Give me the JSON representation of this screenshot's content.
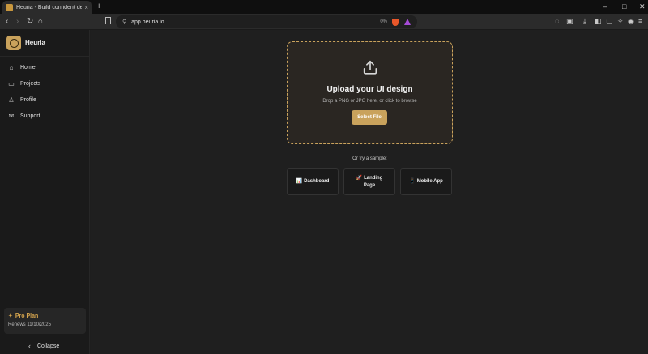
{
  "browser": {
    "tab_title": "Heuria - Build confident design",
    "tab_close": "×",
    "new_tab": "+",
    "url": "app.heuria.io",
    "page_zoom": "0%",
    "window_controls": {
      "minimize": "–",
      "maximize": "□",
      "close": "✕"
    },
    "nav": {
      "back": "‹",
      "forward": "›",
      "reload": "↻",
      "home": "⌂"
    },
    "toolbar_icons": [
      "messages-icon",
      "reader-icon",
      "download-icon",
      "sidebar-icon",
      "wallet-icon",
      "extensions-icon",
      "vpn-icon",
      "menu-icon"
    ]
  },
  "sidebar": {
    "brand": "Heuria",
    "items": [
      {
        "label": "Home",
        "icon": "home-icon",
        "glyph": "⌂"
      },
      {
        "label": "Projects",
        "icon": "folder-icon",
        "glyph": "▭"
      },
      {
        "label": "Profile",
        "icon": "user-icon",
        "glyph": "♙"
      },
      {
        "label": "Support",
        "icon": "mail-icon",
        "glyph": "✉"
      }
    ],
    "plan": {
      "title": "Pro Plan",
      "star": "✦",
      "renews": "Renews 11/10/2025"
    },
    "collapse": {
      "label": "Collapse",
      "glyph": "‹"
    }
  },
  "upload": {
    "title": "Upload your UI design",
    "subtitle": "Drop a PNG or JPG here, or click to browse",
    "button": "Select File"
  },
  "samples": {
    "label": "Or try a sample:",
    "items": [
      {
        "emoji": "📊",
        "label": "Dashboard"
      },
      {
        "emoji": "🚀",
        "label": "Landing Page"
      },
      {
        "emoji": "📱",
        "label": "Mobile App"
      }
    ]
  },
  "colors": {
    "accent": "#c9a25c",
    "background": "#1f1f1f",
    "sidebar": "#1a1a1a"
  }
}
